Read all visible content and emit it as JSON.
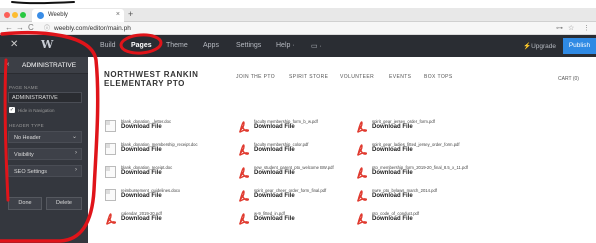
{
  "browser": {
    "tab_title": "Weebly",
    "tab_close": "×",
    "new_tab": "+",
    "url": "weebly.com/editor/main.ph",
    "lock": "ⓘ",
    "back": "←",
    "forward": "→",
    "reload": "C",
    "right_icons": [
      "⊶",
      "☆",
      "⋮"
    ]
  },
  "editor": {
    "close": "✕",
    "logo": "W",
    "menu": [
      "Build",
      "Pages",
      "Theme",
      "Apps",
      "Settings",
      "Help ·"
    ],
    "active_menu": "Pages",
    "device_icon": "▭ ·",
    "upgrade": "⚡Upgrade",
    "publish": "Publish"
  },
  "sidebar": {
    "title": "ADMINISTRATIVE",
    "back": "‹",
    "page_name_label": "PAGE NAME",
    "page_name_value": "ADMINISTRATIVE",
    "hide_label": "Hide in Navigation",
    "header_type_label": "HEADER TYPE",
    "header_type_value": "No Header",
    "visibility": "Visibility",
    "seo": "SEO Settings",
    "done": "Done",
    "delete": "Delete"
  },
  "site": {
    "title_line1": "NORTHWEST RANKIN",
    "title_line2": "ELEMENTARY PTO",
    "nav": [
      "JOIN THE PTO",
      "SPIRIT STORE",
      "VOLUNTEER",
      "EVENTS",
      "BOX TOPS"
    ],
    "cart": "CART (0)"
  },
  "files": [
    {
      "name": "blank_donation_..letter.doc",
      "type": "doc",
      "download": "Download File"
    },
    {
      "name": "faculty membership_form_b_w.pdf",
      "type": "pdf",
      "download": "Download File"
    },
    {
      "name": "spirit_gear_jersey_order_form.pdf",
      "type": "pdf",
      "download": "Download File"
    },
    {
      "name": "blank_donation_membership_receipt.doc",
      "type": "doc",
      "download": "Download File"
    },
    {
      "name": "faculty membership_color.pdf",
      "type": "pdf",
      "download": "Download File"
    },
    {
      "name": "spirit_gear_ladies_fitted_jersey_order_form.pdf",
      "type": "pdf",
      "download": "Download File"
    },
    {
      "name": "blank_donation_receipt.doc",
      "type": "doc",
      "download": "Download File"
    },
    {
      "name": "new_student_parent_pto_welcome BW.pdf",
      "type": "pdf",
      "download": "Download File"
    },
    {
      "name": "pto_membership_form_2019-20_final_8.5_x_11.pdf",
      "type": "pdf",
      "download": "Download File"
    },
    {
      "name": "reimbursement_guidelines.docx",
      "type": "doc",
      "download": "Download File"
    },
    {
      "name": "spirit_gear_cheer_order_form_final.pdf",
      "type": "pdf",
      "download": "Download File"
    },
    {
      "name": "nwre_pto_bylaws_march_2014.pdf",
      "type": "pdf",
      "download": "Download File"
    },
    {
      "name": "calendar_2019-20.pdf",
      "type": "pdf",
      "download": "Download File"
    },
    {
      "name": "w-9_fitted_in.pdf",
      "type": "pdf",
      "download": "Download File"
    },
    {
      "name": "pto_code_of_conduct.pdf",
      "type": "pdf",
      "download": "Download File"
    }
  ],
  "colors": {
    "editor_bar": "#2a2d33",
    "sidebar": "#34373e",
    "publish": "#2f8ae4",
    "annotation": "#e0141a",
    "pdf_red": "#e03a2f"
  }
}
